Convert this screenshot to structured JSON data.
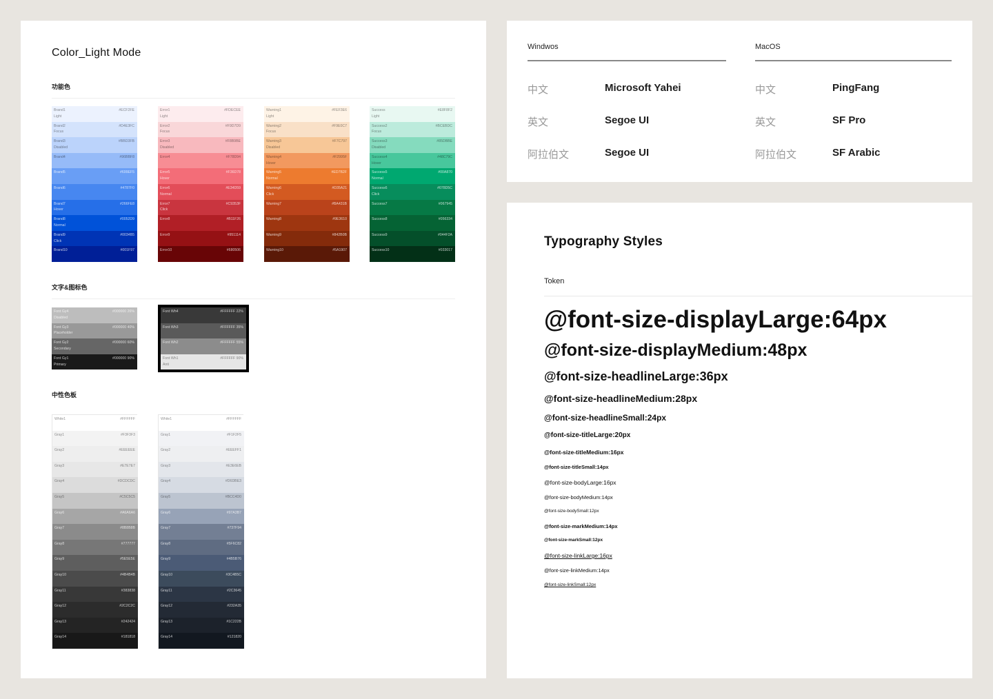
{
  "color_panel": {
    "title": "Color_Light Mode",
    "section_functional": "功能色",
    "section_text_icon": "文字&图标色",
    "section_neutral": "中性色板",
    "functional_columns": [
      [
        {
          "name": "Brand1\nLight",
          "hex": "#ECF2FE",
          "color": "#ecf2fe",
          "dark": false
        },
        {
          "name": "Brand2\nFocus",
          "hex": "#D4E3FC",
          "color": "#d4e3fc",
          "dark": false
        },
        {
          "name": "Brand3\nDisabled",
          "hex": "#BBD3FB",
          "color": "#bbd3fb",
          "dark": false
        },
        {
          "name": "Brand4",
          "hex": "#96BBF8",
          "color": "#96bbf8",
          "dark": false
        },
        {
          "name": "Brand5",
          "hex": "#699EF5",
          "color": "#699ef5",
          "dark": true
        },
        {
          "name": "Brand6",
          "hex": "#4787F0",
          "color": "#4787f0",
          "dark": true
        },
        {
          "name": "Brand7\nHover",
          "hex": "#266FE8",
          "color": "#266fe8",
          "dark": true
        },
        {
          "name": "Brand8\nNormal",
          "hex": "#0052D9",
          "color": "#0052d9",
          "dark": true
        },
        {
          "name": "Brand9\nClick",
          "hex": "#0034B5",
          "color": "#0034b5",
          "dark": true
        },
        {
          "name": "Brand10",
          "hex": "#001F97",
          "color": "#001f97",
          "dark": true
        }
      ],
      [
        {
          "name": "Error1\nLight",
          "hex": "#FDECEE",
          "color": "#fdecee",
          "dark": false
        },
        {
          "name": "Error2\nFocus",
          "hex": "#F9D7D9",
          "color": "#f9d7d9",
          "dark": false
        },
        {
          "name": "Error3\nDisabled",
          "hex": "#F8B9BE",
          "color": "#f8b9be",
          "dark": false
        },
        {
          "name": "Error4",
          "hex": "#F78D94",
          "color": "#f78d94",
          "dark": false
        },
        {
          "name": "Error5\nHover",
          "hex": "#F36D78",
          "color": "#f36d78",
          "dark": true
        },
        {
          "name": "Error6\nNormal",
          "hex": "#E34D59",
          "color": "#e34d59",
          "dark": true
        },
        {
          "name": "Error7\nClick",
          "hex": "#C9353F",
          "color": "#c9353f",
          "dark": true
        },
        {
          "name": "Error8",
          "hex": "#B11F26",
          "color": "#b11f26",
          "dark": true
        },
        {
          "name": "Error9",
          "hex": "#951114",
          "color": "#951114",
          "dark": true
        },
        {
          "name": "Error10",
          "hex": "#680506",
          "color": "#680506",
          "dark": true
        }
      ],
      [
        {
          "name": "Warning1\nLight",
          "hex": "#FEF3E6",
          "color": "#fef3e6",
          "dark": false
        },
        {
          "name": "Warning2\nFocus",
          "hex": "#F9E0C7",
          "color": "#f9e0c7",
          "dark": false
        },
        {
          "name": "Warning3\nDisabled",
          "hex": "#F7C797",
          "color": "#f7c797",
          "dark": false
        },
        {
          "name": "Warning4\nHover",
          "hex": "#F2995F",
          "color": "#f2995f",
          "dark": false
        },
        {
          "name": "Warning5\nNormal",
          "hex": "#ED7B2F",
          "color": "#ed7b2f",
          "dark": true
        },
        {
          "name": "Warning6\nClick",
          "hex": "#D35A21",
          "color": "#d35a21",
          "dark": true
        },
        {
          "name": "Warning7",
          "hex": "#BA431B",
          "color": "#ba431b",
          "dark": true
        },
        {
          "name": "Warning8",
          "hex": "#9E3610",
          "color": "#9e3610",
          "dark": true
        },
        {
          "name": "Warning9",
          "hex": "#842B0B",
          "color": "#842b0b",
          "dark": true
        },
        {
          "name": "Warning10",
          "hex": "#5A1907",
          "color": "#5a1907",
          "dark": true
        }
      ],
      [
        {
          "name": "Success\nLight",
          "hex": "#E8F8F2",
          "color": "#e8f8f2",
          "dark": false
        },
        {
          "name": "Success2\nFocus",
          "hex": "#BCEBDC",
          "color": "#bcebdc",
          "dark": false
        },
        {
          "name": "Success3\nDisabled",
          "hex": "#85DBBE",
          "color": "#85dbbe",
          "dark": false
        },
        {
          "name": "Success4\nHover",
          "hex": "#48C79C",
          "color": "#48c79c",
          "dark": false
        },
        {
          "name": "Success5\nNormal",
          "hex": "#00A870",
          "color": "#00a870",
          "dark": true
        },
        {
          "name": "Success6\nClick",
          "hex": "#078D5C",
          "color": "#078d5c",
          "dark": true
        },
        {
          "name": "Success7",
          "hex": "#067945",
          "color": "#067945",
          "dark": true
        },
        {
          "name": "Success8",
          "hex": "#056334",
          "color": "#056334",
          "dark": true
        },
        {
          "name": "Success9",
          "hex": "#044F2A",
          "color": "#044f2a",
          "dark": true
        },
        {
          "name": "Success10",
          "hex": "#033017",
          "color": "#033017",
          "dark": true
        }
      ]
    ],
    "text_icon_columns": [
      [
        {
          "name": "Font Gy4\nDisabled",
          "hex": "#000000 26%",
          "color": "#bdbdbd",
          "dark": true
        },
        {
          "name": "Font Gy3\nPlaceholder",
          "hex": "#000000 40%",
          "color": "#999999",
          "dark": true
        },
        {
          "name": "Font Gy2\nSecondary",
          "hex": "#000000 60%",
          "color": "#666666",
          "dark": true
        },
        {
          "name": "Font Gy1\nPrimary",
          "hex": "#000000 90%",
          "color": "#1a1a1a",
          "dark": true
        }
      ],
      [
        {
          "name": "Font Wh4",
          "hex": "#FFFFFF 22%",
          "color": "#393939",
          "dark": true
        },
        {
          "name": "Font Wh3",
          "hex": "#FFFFFF 35%",
          "color": "#5a5a5a",
          "dark": true
        },
        {
          "name": "Font Wh2",
          "hex": "#FFFFFF 55%",
          "color": "#8c8c8c",
          "dark": true
        },
        {
          "name": "Font Wh1\nAnti",
          "hex": "#FFFFFF 90%",
          "color": "#e6e6e6",
          "dark": false
        }
      ]
    ],
    "neutral_columns": [
      [
        {
          "name": "White1",
          "hex": "#FFFFFF",
          "color": "#ffffff",
          "dark": false
        },
        {
          "name": "Gray1",
          "hex": "#F3F3F3",
          "color": "#f3f3f3",
          "dark": false
        },
        {
          "name": "Gray2",
          "hex": "#EEEEEE",
          "color": "#eeeeee",
          "dark": false
        },
        {
          "name": "Gray3",
          "hex": "#E7E7E7",
          "color": "#e7e7e7",
          "dark": false
        },
        {
          "name": "Gray4",
          "hex": "#DCDCDC",
          "color": "#dcdcdc",
          "dark": false
        },
        {
          "name": "Gray5",
          "hex": "#C5C5C5",
          "color": "#c5c5c5",
          "dark": false
        },
        {
          "name": "Gray6",
          "hex": "#A6A6A6",
          "color": "#a6a6a6",
          "dark": true
        },
        {
          "name": "Gray7",
          "hex": "#8B8B8B",
          "color": "#8b8b8b",
          "dark": true
        },
        {
          "name": "Gray8",
          "hex": "#777777",
          "color": "#777777",
          "dark": true
        },
        {
          "name": "Gray9",
          "hex": "#5E5E5E",
          "color": "#5e5e5e",
          "dark": true
        },
        {
          "name": "Gray10",
          "hex": "#4B4B4B",
          "color": "#4b4b4b",
          "dark": true
        },
        {
          "name": "Gray11",
          "hex": "#383838",
          "color": "#383838",
          "dark": true
        },
        {
          "name": "Gray12",
          "hex": "#2C2C2C",
          "color": "#2c2c2c",
          "dark": true
        },
        {
          "name": "Gray13",
          "hex": "#242424",
          "color": "#242424",
          "dark": true
        },
        {
          "name": "Gray14",
          "hex": "#181818",
          "color": "#181818",
          "dark": true
        }
      ],
      [
        {
          "name": "White1",
          "hex": "#FFFFFF",
          "color": "#ffffff",
          "dark": false
        },
        {
          "name": "Gray1",
          "hex": "#F1F2F5",
          "color": "#f1f2f5",
          "dark": false
        },
        {
          "name": "Gray2",
          "hex": "#EEEFF1",
          "color": "#eeeff1",
          "dark": false
        },
        {
          "name": "Gray3",
          "hex": "#E3E6EB",
          "color": "#e3e6eb",
          "dark": false
        },
        {
          "name": "Gray4",
          "hex": "#D6DBE3",
          "color": "#d6dbe3",
          "dark": false
        },
        {
          "name": "Gray5",
          "hex": "#BCC4D0",
          "color": "#bcc4d0",
          "dark": false
        },
        {
          "name": "Gray6",
          "hex": "#97A3B7",
          "color": "#97a3b7",
          "dark": true
        },
        {
          "name": "Gray7",
          "hex": "#737F94",
          "color": "#737f94",
          "dark": true
        },
        {
          "name": "Gray8",
          "hex": "#5F6C82",
          "color": "#5f6c82",
          "dark": true
        },
        {
          "name": "Gray9",
          "hex": "#4B5B76",
          "color": "#4b5b76",
          "dark": true
        },
        {
          "name": "Gray10",
          "hex": "#3C4B5C",
          "color": "#3c4b5c",
          "dark": true
        },
        {
          "name": "Gray11",
          "hex": "#2C3645",
          "color": "#2c3645",
          "dark": true
        },
        {
          "name": "Gray12",
          "hex": "#232A35",
          "color": "#232a35",
          "dark": true
        },
        {
          "name": "Gray13",
          "hex": "#1C222B",
          "color": "#1c222b",
          "dark": true
        },
        {
          "name": "Gray14",
          "hex": "#121820",
          "color": "#121820",
          "dark": true
        }
      ]
    ]
  },
  "font_panel": {
    "windows_title": "Windwos",
    "mac_title": "MacOS",
    "windows_rows": [
      {
        "lang": "中文",
        "font": "Microsoft Yahei"
      },
      {
        "lang": "英文",
        "font": "Segoe UI"
      },
      {
        "lang": "阿拉伯文",
        "font": "Segoe UI"
      }
    ],
    "mac_rows": [
      {
        "lang": "中文",
        "font": "PingFang"
      },
      {
        "lang": "英文",
        "font": "SF Pro"
      },
      {
        "lang": "阿拉伯文",
        "font": "SF Arabic"
      }
    ]
  },
  "type_panel": {
    "title": "Typography Styles",
    "token_label": "Token",
    "tokens": [
      "@font-size-displayLarge:64px",
      "@font-size-displayMedium:48px",
      "@font-size-headlineLarge:36px",
      "@font-size-headlineMedium:28px",
      "@font-size-headlineSmall:24px",
      "@font-size-titleLarge:20px",
      "@font-size-titleMedium:16px",
      "@font-size-titleSmall:14px",
      "@font-size-bodyLarge:16px",
      "@font-size-bodyMedium:14px",
      "@font-size-bodySmall:12px",
      "@font-size-markMedium:14px",
      "@font-size-markSmall:12px",
      "@font-size-linkLarge:16px",
      "@font-size-linkMedium:14px",
      "@font-size-linkSmall:12px"
    ]
  }
}
